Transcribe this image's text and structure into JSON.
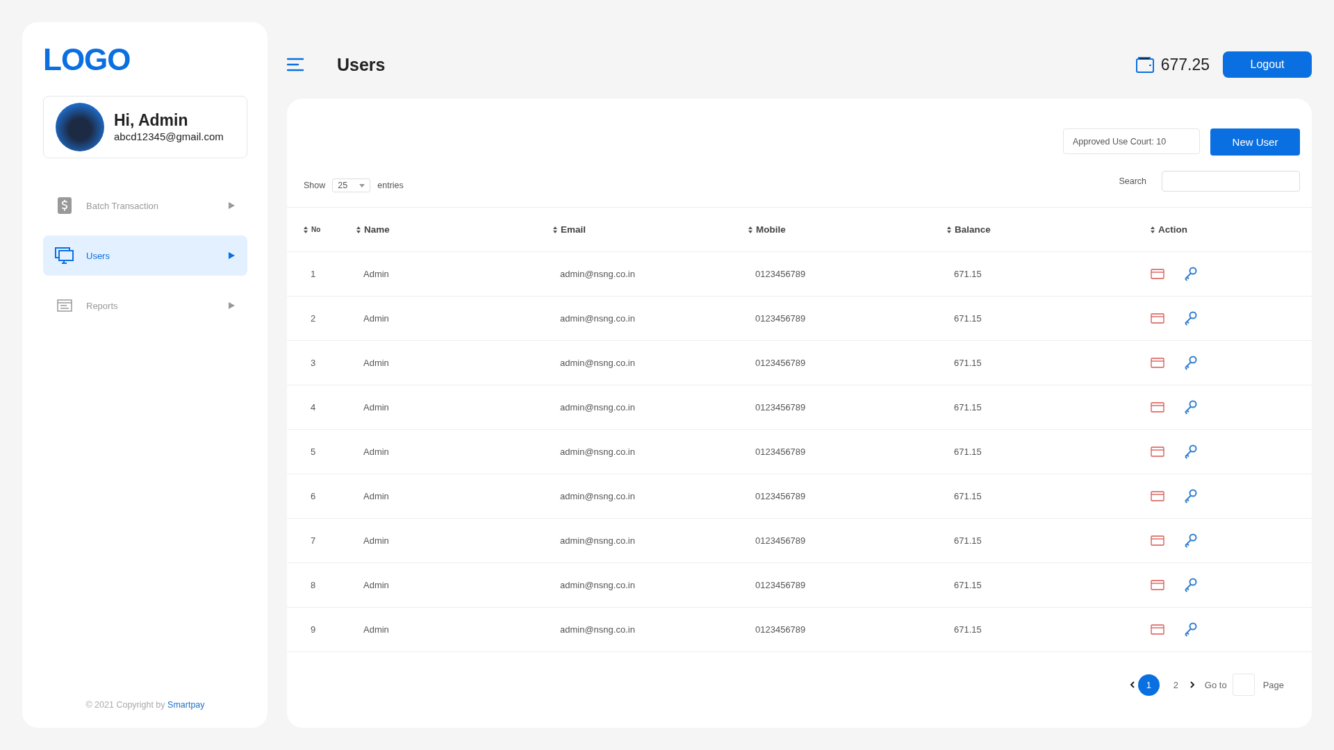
{
  "sidebar": {
    "logo": "LOGO",
    "profile": {
      "greeting": "Hi, Admin",
      "email": "abcd12345@gmail.com"
    },
    "items": [
      {
        "kind": "dollar",
        "label": "Batch Transaction",
        "selected": false
      },
      {
        "kind": "monitor",
        "label": "Users",
        "selected": true
      },
      {
        "kind": "report",
        "label": "Reports",
        "selected": false
      }
    ],
    "footer": {
      "text": "© 2021 Copyright by",
      "link": "Smartpay"
    }
  },
  "header": {
    "title": "Users",
    "balance": "677.25",
    "logout": "Logout"
  },
  "toolbar": {
    "approved_count": "Approved Use Court: 10",
    "new_user": "New User",
    "show_label": "Show",
    "page_size": "25",
    "entries_label": "entries",
    "search_label": "Search"
  },
  "table": {
    "columns": [
      "No",
      "Name",
      "Email",
      "Mobile",
      "Balance",
      "Action"
    ],
    "rows": [
      {
        "no": "1",
        "name": "Admin",
        "email": "admin@nsng.co.in",
        "mobile": "0123456789",
        "balance": "671.15"
      },
      {
        "no": "2",
        "name": "Admin",
        "email": "admin@nsng.co.in",
        "mobile": "0123456789",
        "balance": "671.15"
      },
      {
        "no": "3",
        "name": "Admin",
        "email": "admin@nsng.co.in",
        "mobile": "0123456789",
        "balance": "671.15"
      },
      {
        "no": "4",
        "name": "Admin",
        "email": "admin@nsng.co.in",
        "mobile": "0123456789",
        "balance": "671.15"
      },
      {
        "no": "5",
        "name": "Admin",
        "email": "admin@nsng.co.in",
        "mobile": "0123456789",
        "balance": "671.15"
      },
      {
        "no": "6",
        "name": "Admin",
        "email": "admin@nsng.co.in",
        "mobile": "0123456789",
        "balance": "671.15"
      },
      {
        "no": "7",
        "name": "Admin",
        "email": "admin@nsng.co.in",
        "mobile": "0123456789",
        "balance": "671.15"
      },
      {
        "no": "8",
        "name": "Admin",
        "email": "admin@nsng.co.in",
        "mobile": "0123456789",
        "balance": "671.15"
      },
      {
        "no": "9",
        "name": "Admin",
        "email": "admin@nsng.co.in",
        "mobile": "0123456789",
        "balance": "671.15"
      }
    ]
  },
  "pagination": {
    "pages": [
      {
        "label": "1",
        "selected": true
      },
      {
        "label": "2",
        "selected": false
      }
    ],
    "goto_label": "Go to",
    "page_label": "Page"
  }
}
